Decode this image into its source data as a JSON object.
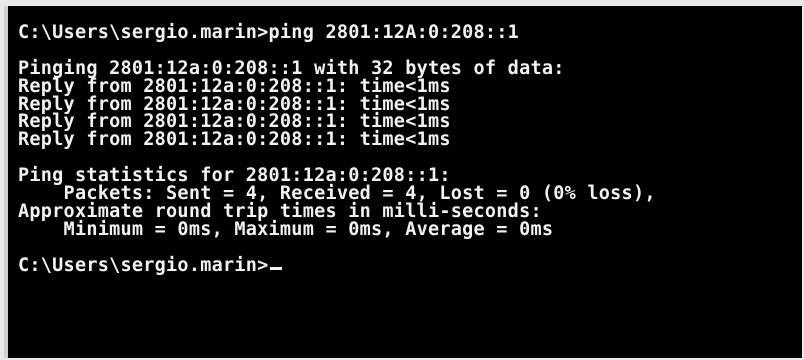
{
  "window": {
    "background": "#000000",
    "text_color": "#f2f2f2"
  },
  "console": {
    "command_prompt": "C:\\Users\\sergio.marin>ping 2801:12A:0:208::1",
    "pinging_line": "Pinging 2801:12a:0:208::1 with 32 bytes of data:",
    "reply_lines": [
      "Reply from 2801:12a:0:208::1: time<1ms",
      "Reply from 2801:12a:0:208::1: time<1ms",
      "Reply from 2801:12a:0:208::1: time<1ms",
      "Reply from 2801:12a:0:208::1: time<1ms"
    ],
    "stats_header": "Ping statistics for 2801:12a:0:208::1:",
    "packets_line": "    Packets: Sent = 4, Received = 4, Lost = 0 (0% loss),",
    "approx_line": "Approximate round trip times in milli-seconds:",
    "times_line": "    Minimum = 0ms, Maximum = 0ms, Average = 0ms",
    "final_prompt": "C:\\Users\\sergio.marin>"
  }
}
